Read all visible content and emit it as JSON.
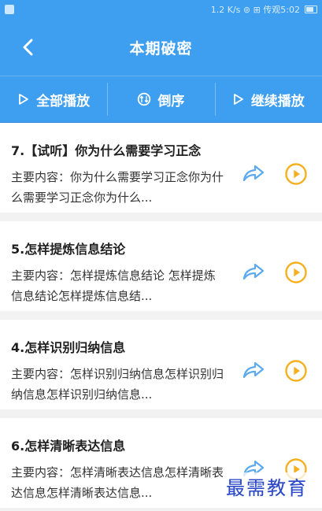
{
  "status_bar": {
    "text": "1.2 K/s  ⊚ ⊞   传观5:02"
  },
  "header": {
    "title": "本期破密"
  },
  "toolbar": {
    "items": [
      {
        "label": "全部播放",
        "icon": "play-outline-icon"
      },
      {
        "label": "倒序",
        "icon": "sort-circle-icon"
      },
      {
        "label": "继续播放",
        "icon": "play-outline-icon"
      }
    ]
  },
  "list": {
    "items": [
      {
        "title": "7.【试听】你为什么需要学习正念",
        "desc": "主要内容：你为什么需要学习正念你为什么需要学习正念你为什么..."
      },
      {
        "title": "5.怎样提炼信息结论",
        "desc": "主要内容：怎样提炼信息结论 怎样提炼信息结论怎样提炼信息结..."
      },
      {
        "title": "4.怎样识别归纳信息",
        "desc": "主要内容：怎样识别归纳信息怎样识别归纳信息怎样识别归纳信息..."
      },
      {
        "title": "6.怎样清晰表达信息",
        "desc": "主要内容：怎样清晰表达信息怎样清晰表达信息怎样清晰表达信息..."
      }
    ]
  },
  "watermark": "最需教育",
  "colors": {
    "primary": "#3e9ef0",
    "share": "#5ba9ef",
    "play": "#f4b01f"
  }
}
